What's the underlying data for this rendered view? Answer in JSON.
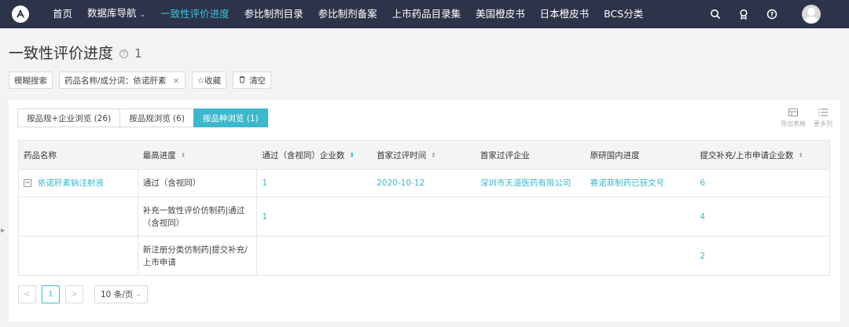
{
  "nav": {
    "items": [
      {
        "label": "首页"
      },
      {
        "label": "数据库导航",
        "dropdown": true
      },
      {
        "label": "一致性评价进度",
        "active": true
      },
      {
        "label": "参比制剂目录"
      },
      {
        "label": "参比制剂备案"
      },
      {
        "label": "上市药品目录集"
      },
      {
        "label": "美国橙皮书"
      },
      {
        "label": "日本橙皮书"
      },
      {
        "label": "BCS分类"
      }
    ],
    "right_icons": [
      "search-icon",
      "award-icon",
      "help-icon"
    ],
    "accent_color": "#3cc3dc",
    "bg_color": "#2d3348"
  },
  "page": {
    "title": "一致性评价进度",
    "count": "1"
  },
  "filters": {
    "fuzzy_search": "模糊搜索",
    "tag": "药品名称/成分词：依诺肝素",
    "tag_close": "×",
    "favorite": "☆收藏",
    "clear": "清空"
  },
  "tabs": [
    {
      "label": "按品规+企业浏览 (26)"
    },
    {
      "label": "按品规浏览 (6)"
    },
    {
      "label": "按品种浏览 (1)",
      "active": true
    }
  ],
  "tools": {
    "export": "导出表格",
    "more_columns": "更多列"
  },
  "table": {
    "headers": [
      "药品名称",
      "最高进度",
      "通过（含视同）企业数",
      "首家过评时间",
      "首家过评企业",
      "原研国内进度",
      "提交补充/上市申请企业数"
    ],
    "rows": [
      {
        "drug": "依诺肝素钠注射液",
        "progress": "通过（含视同）",
        "passed": "1",
        "first_time": "2020-10-12",
        "first_company": "深圳市天道医药有限公司",
        "original": "赛诺菲制药已获文号",
        "submitted": "6"
      },
      {
        "drug": "",
        "progress": "补充一致性评价仿制药|通过（含视同）",
        "passed": "1",
        "first_time": "",
        "first_company": "",
        "original": "",
        "submitted": "4"
      },
      {
        "drug": "",
        "progress": "新注册分类仿制药|提交补充/上市申请",
        "passed": "",
        "first_time": "",
        "first_company": "",
        "original": "",
        "submitted": "2"
      }
    ]
  },
  "pagination": {
    "prev": "<",
    "current": "1",
    "next": ">",
    "page_size": "10 条/页"
  }
}
